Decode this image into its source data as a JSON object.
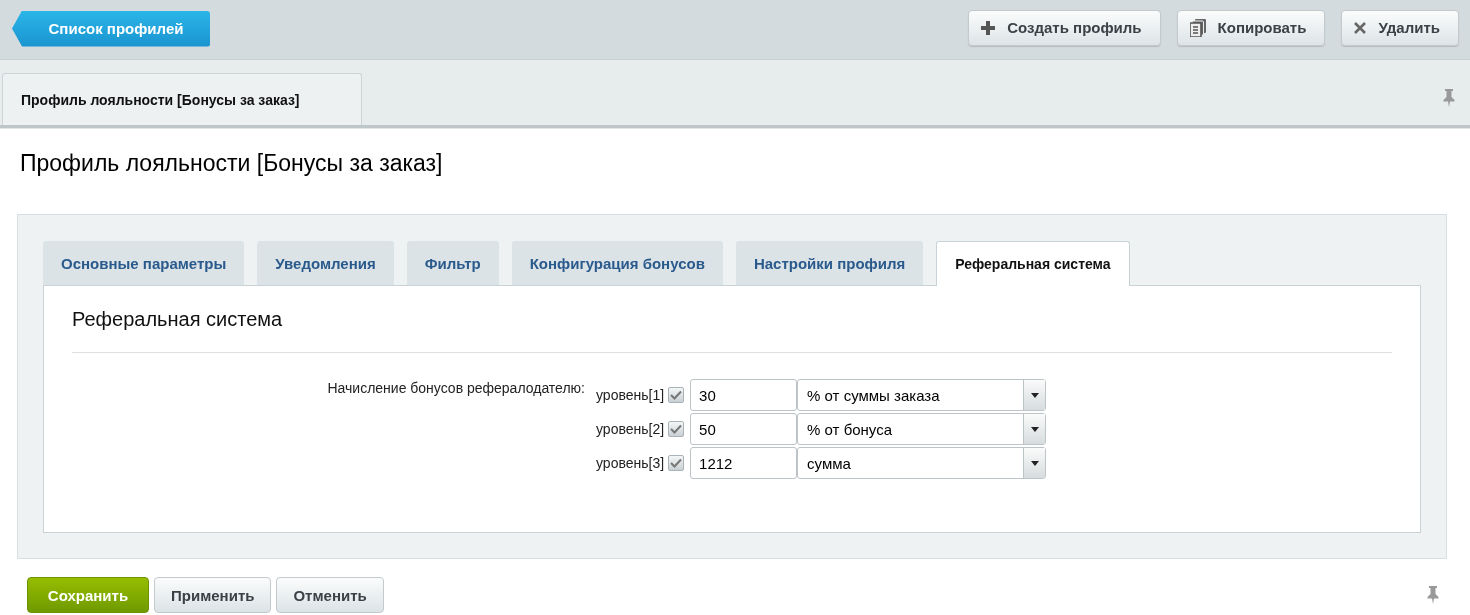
{
  "back_button": {
    "label": "Список профилей"
  },
  "toolbar_buttons": [
    {
      "label": "Создать профиль",
      "kind": "add"
    },
    {
      "label": "Копировать",
      "kind": "copy"
    },
    {
      "label": "Удалить",
      "kind": "delete"
    }
  ],
  "page_tabs": [
    {
      "label": "Профиль лояльности [Бонусы за заказ]",
      "selected": true
    }
  ],
  "page_title": "Профиль лояльности [Бонусы за заказ]",
  "form_tabs": [
    {
      "label": "Основные параметры",
      "selected": false
    },
    {
      "label": "Уведомления",
      "selected": false
    },
    {
      "label": "Фильтр",
      "selected": false
    },
    {
      "label": "Конфигурация бонусов",
      "selected": false
    },
    {
      "label": "Настройки профиля",
      "selected": false
    },
    {
      "label": "Реферальная система",
      "selected": true
    }
  ],
  "section_title": "Реферальная система",
  "field": {
    "label": "Начисление бонусов рефералодателю:",
    "levels": [
      {
        "label": "уровень[1]",
        "checked": true,
        "value": "30",
        "unit": "% от суммы заказа"
      },
      {
        "label": "уровень[2]",
        "checked": true,
        "value": "50",
        "unit": "% от бонуса"
      },
      {
        "label": "уровень[3]",
        "checked": true,
        "value": "1212",
        "unit": "сумма"
      }
    ]
  },
  "footer_buttons": [
    {
      "label": "Сохранить",
      "kind": "primary"
    },
    {
      "label": "Применить",
      "kind": "normal"
    },
    {
      "label": "Отменить",
      "kind": "normal"
    }
  ]
}
